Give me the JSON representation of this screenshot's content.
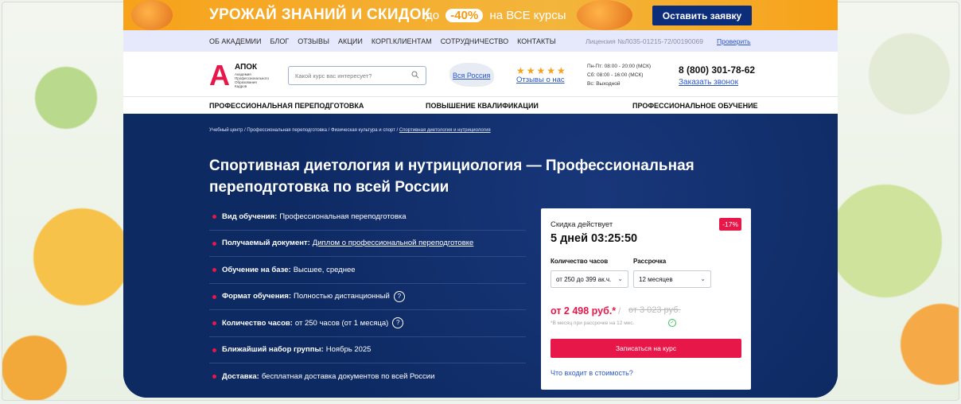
{
  "promo": {
    "title": "УРОЖАЙ ЗНАНИЙ И СКИДОК",
    "prefix": "до",
    "discount": "-40%",
    "suffix": "на ВСЕ курсы",
    "button": "Оставить заявку"
  },
  "topnav": {
    "items": [
      "ОБ АКАДЕМИИ",
      "БЛОГ",
      "ОТЗЫВЫ",
      "АКЦИИ",
      "КОРП.КЛИЕНТАМ",
      "СОТРУДНИЧЕСТВО",
      "КОНТАКТЫ"
    ],
    "license": "Лицензия №Л035-01215-72/00190069",
    "check": "Проверить"
  },
  "header": {
    "logo_letter": "А",
    "logo_name": "АПОК",
    "logo_sub": "Академия Профессионального Образования Кадров",
    "search_placeholder": "Какой курс вас интересует?",
    "region": "Вся Россия",
    "stars": "★★★★★",
    "reviews": "Отзывы о нас",
    "hours": [
      "Пн-Пт: 08:00 - 20:00 (МСК)",
      "Сб: 08:00 - 16:00 (МСК)",
      "Вс: Выходной"
    ],
    "phone": "8 (800) 301-78-62",
    "callback": "Заказать звонок"
  },
  "catmenu": [
    "ПРОФЕССИОНАЛЬНАЯ ПЕРЕПОДГОТОВКА",
    "ПОВЫШЕНИЕ КВАЛИФИКАЦИИ",
    "ПРОФЕССИОНАЛЬНОЕ ОБУЧЕНИЕ"
  ],
  "breadcrumbs": [
    "Учебный центр",
    "Профессиональная переподготовка",
    "Физическая культура и спорт",
    "Спортивная диетология и нутрициология"
  ],
  "title": "Спортивная диетология и нутрициология — Профессиональная переподготовка по всей России",
  "features": [
    {
      "label": "Вид обучения:",
      "value": "Профессиональная переподготовка"
    },
    {
      "label": "Получаемый документ:",
      "value": "Диплом о профессиональной переподготовке"
    },
    {
      "label": "Обучение на базе:",
      "value": "Высшее, среднее"
    },
    {
      "label": "Формат обучения:",
      "value": "Полностью дистанционный"
    },
    {
      "label": "Количество часов:",
      "value": "от 250 часов (от 1 месяца)"
    },
    {
      "label": "Ближайший набор группы:",
      "value": "Ноябрь 2025"
    },
    {
      "label": "Доставка:",
      "value": "бесплатная доставка документов по всей России"
    }
  ],
  "card": {
    "discount_label": "Скидка действует",
    "timer": "5 дней 03:25:50",
    "badge": "-17%",
    "hours_label": "Количество часов",
    "hours_value": "от 250 до 399 ак.ч.",
    "installment_label": "Рассрочка",
    "installment_value": "12 месяцев",
    "price": "от 2 498 руб.*",
    "slash": "/",
    "old_price": "от 3 023 руб.",
    "note": "*В месяц при рассрочке на 12 мес.",
    "button": "Записаться на курс",
    "link": "Что входит в стоимость?"
  },
  "colors": {
    "accent": "#e8174a",
    "navy": "#0e2a63",
    "promo": "#f7a21a",
    "link": "#2a56c6"
  }
}
